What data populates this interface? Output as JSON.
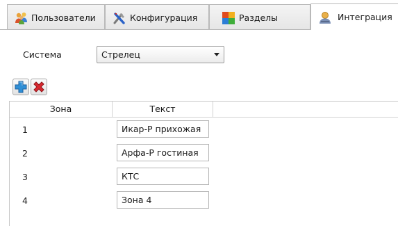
{
  "tabs": [
    {
      "label": "Пользователи",
      "icon": "users-icon"
    },
    {
      "label": "Конфигурация",
      "icon": "tools-icon"
    },
    {
      "label": "Разделы",
      "icon": "sections-icon"
    },
    {
      "label": "Интеграция",
      "icon": "integration-icon"
    }
  ],
  "active_tab": "Интеграция",
  "system": {
    "label": "Система",
    "value": "Стрелец"
  },
  "toolbar": {
    "add": "plus-icon",
    "delete": "delete-x-icon"
  },
  "table": {
    "columns": [
      "Зона",
      "Текст"
    ],
    "rows": [
      {
        "zone": "1",
        "text": "Икар-Р прихожая"
      },
      {
        "zone": "2",
        "text": "Арфа-Р гостиная"
      },
      {
        "zone": "3",
        "text": "КТС"
      },
      {
        "zone": "4",
        "text": "Зона 4"
      }
    ]
  },
  "colors": {
    "tab_border": "#b9b9b9",
    "grid_line": "#d2d2d2",
    "plus_blue": "#2f8fd6",
    "delete_red": "#d8282f"
  }
}
